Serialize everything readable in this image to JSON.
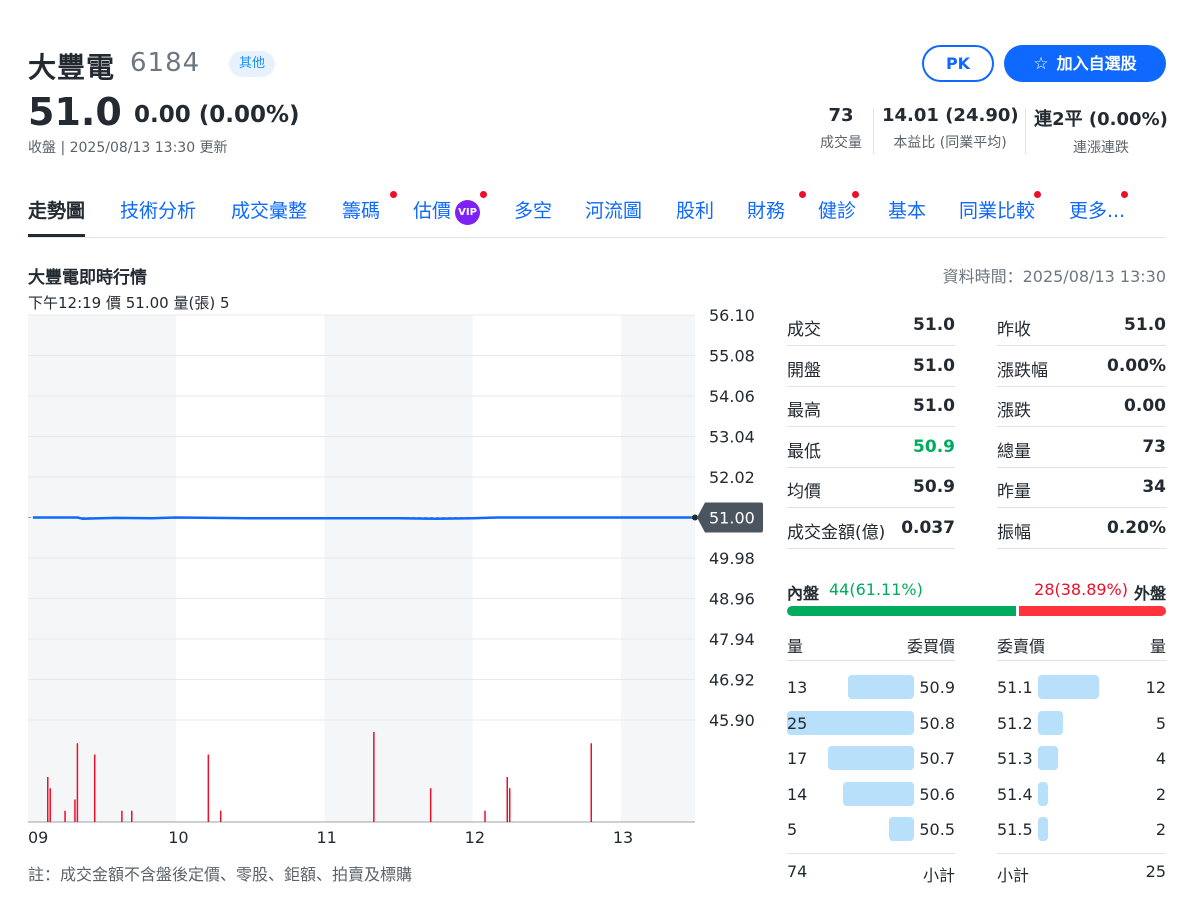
{
  "header": {
    "name": "大豐電",
    "code": "6184",
    "badge": "其他",
    "price": "51.0",
    "change": "0.00 (0.00%)",
    "close_info": "收盤 | 2025/08/13 13:30 更新",
    "pk_label": "PK",
    "watch_label": "加入自選股",
    "stats": [
      {
        "value": "73",
        "label": "成交量"
      },
      {
        "value": "14.01 (24.90)",
        "label": "本益比 (同業平均)"
      },
      {
        "value": "連2平 (0.00%)",
        "label": "連漲連跌"
      }
    ]
  },
  "tabs": [
    {
      "label": "走勢圖",
      "active": true,
      "dot": false
    },
    {
      "label": "技術分析",
      "dot": false
    },
    {
      "label": "成交彙整",
      "dot": false
    },
    {
      "label": "籌碼",
      "dot": true
    },
    {
      "label": "估價",
      "dot": true,
      "vip": "VIP"
    },
    {
      "label": "多空",
      "dot": false
    },
    {
      "label": "河流圖",
      "dot": false
    },
    {
      "label": "股利",
      "dot": false
    },
    {
      "label": "財務",
      "dot": true
    },
    {
      "label": "健診",
      "dot": true
    },
    {
      "label": "基本",
      "dot": false
    },
    {
      "label": "同業比較",
      "dot": true
    },
    {
      "label": "更多...",
      "dot": true
    }
  ],
  "section": {
    "title": "大豐電即時行情",
    "data_time": "資料時間：2025/08/13 13:30",
    "tooltip": "下午12:19  價 51.00  量(張) 5",
    "footnote": "註：成交金額不含盤後定價、零股、鉅額、拍賣及標購"
  },
  "chart_data": {
    "type": "line",
    "y_ticks": [
      "56.10",
      "55.08",
      "54.06",
      "53.04",
      "52.02",
      "51.00",
      "49.98",
      "48.96",
      "47.94",
      "46.92",
      "45.90"
    ],
    "ylim": [
      45.9,
      56.1
    ],
    "x_ticks": [
      "09",
      "10",
      "11",
      "12",
      "13"
    ],
    "current_price_label": "51.00",
    "reference_price": 51.0,
    "series": [
      {
        "x": [
          "09:02",
          "09:20",
          "09:22",
          "09:35",
          "09:50",
          "10:00",
          "10:30",
          "11:00",
          "11:30",
          "11:45",
          "12:00",
          "12:10",
          "12:30",
          "13:00",
          "13:30"
        ],
        "values": [
          51.0,
          51.0,
          50.97,
          50.99,
          50.98,
          51.0,
          50.98,
          50.98,
          50.98,
          50.97,
          50.98,
          51.0,
          51.0,
          51.0,
          51.0
        ]
      }
    ],
    "volume": {
      "x": [
        "09:08",
        "09:09",
        "09:15",
        "09:19",
        "09:20",
        "09:27",
        "09:38",
        "09:42",
        "10:13",
        "10:18",
        "11:20",
        "11:43",
        "12:05",
        "12:14",
        "12:15",
        "12:48"
      ],
      "values": [
        4,
        3,
        1,
        2,
        7,
        6,
        1,
        1,
        6,
        1,
        8,
        3,
        1,
        4,
        3,
        7
      ]
    }
  },
  "quote_left": [
    {
      "label": "成交",
      "value": "51.0"
    },
    {
      "label": "開盤",
      "value": "51.0"
    },
    {
      "label": "最高",
      "value": "51.0"
    },
    {
      "label": "最低",
      "value": "50.9",
      "color": "#00ab5e"
    },
    {
      "label": "均價",
      "value": "50.9"
    },
    {
      "label": "成交金額(億)",
      "value": "0.037"
    }
  ],
  "quote_right": [
    {
      "label": "昨收",
      "value": "51.0"
    },
    {
      "label": "漲跌幅",
      "value": "0.00%"
    },
    {
      "label": "漲跌",
      "value": "0.00"
    },
    {
      "label": "總量",
      "value": "73"
    },
    {
      "label": "昨量",
      "value": "34"
    },
    {
      "label": "振幅",
      "value": "0.20%"
    }
  ],
  "inner_outer": {
    "inner_label": "內盤",
    "inner_value": "44(61.11%)",
    "outer_value": "28(38.89%)",
    "outer_label": "外盤",
    "inner_ratio": 0.6111
  },
  "order_book": {
    "head": {
      "vol": "量",
      "bid": "委買價",
      "ask": "委賣價",
      "vol2": "量"
    },
    "bids": [
      {
        "vol": "13",
        "price": "50.9"
      },
      {
        "vol": "25",
        "price": "50.8"
      },
      {
        "vol": "17",
        "price": "50.7"
      },
      {
        "vol": "14",
        "price": "50.6"
      },
      {
        "vol": "5",
        "price": "50.5"
      }
    ],
    "asks": [
      {
        "price": "51.1",
        "vol": "12"
      },
      {
        "price": "51.2",
        "vol": "5"
      },
      {
        "price": "51.3",
        "vol": "4"
      },
      {
        "price": "51.4",
        "vol": "2"
      },
      {
        "price": "51.5",
        "vol": "2"
      }
    ],
    "foot": {
      "bid_total": "74",
      "bid_label": "小計",
      "ask_label": "小計",
      "ask_total": "25"
    }
  }
}
